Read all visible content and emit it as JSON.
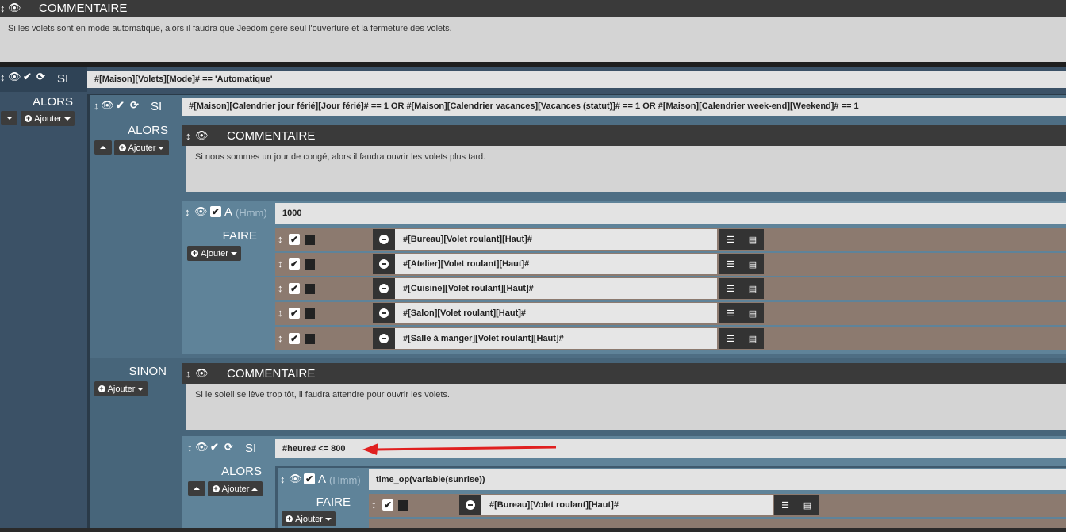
{
  "top_comment": {
    "title": "COMMENTAIRE",
    "text": "Si les volets sont en mode automatique, alors il faudra que Jeedom gère seul l'ouverture et la fermeture des volets."
  },
  "si1": {
    "keyword": "SI",
    "condition": "#[Maison][Volets][Mode]# == 'Automatique'",
    "alors": "ALORS",
    "ajouter": "Ajouter"
  },
  "si2": {
    "keyword": "SI",
    "condition": "#[Maison][Calendrier jour férié][Jour férié]# == 1 OR #[Maison][Calendrier vacances][Vacances (statut)]# == 1 OR #[Maison][Calendrier week-end][Weekend]# == 1",
    "alors": "ALORS",
    "ajouter": "Ajouter",
    "comment_title": "COMMENTAIRE",
    "comment_text": "Si nous sommes un jour de congé, alors il faudra ouvrir les volets plus tard.",
    "a_label": "A",
    "a_hint": "(Hmm)",
    "a_value": "1000",
    "faire": "FAIRE",
    "faire_ajouter": "Ajouter",
    "actions": [
      {
        "cmd": "#[Bureau][Volet roulant][Haut]#"
      },
      {
        "cmd": "#[Atelier][Volet roulant][Haut]#"
      },
      {
        "cmd": "#[Cuisine][Volet roulant][Haut]#"
      },
      {
        "cmd": "#[Salon][Volet roulant][Haut]#"
      },
      {
        "cmd": "#[Salle à manger][Volet roulant][Haut]#"
      }
    ],
    "sinon": "SINON",
    "sinon_ajouter": "Ajouter",
    "sinon_comment_title": "COMMENTAIRE",
    "sinon_comment_text": "Si le soleil se lève trop tôt, il faudra attendre pour ouvrir les volets."
  },
  "si3": {
    "keyword": "SI",
    "condition": "#heure# <= 800",
    "alors": "ALORS",
    "ajouter": "Ajouter",
    "a_label": "A",
    "a_hint": "(Hmm)",
    "a_value": "time_op(variable(sunrise))",
    "faire": "FAIRE",
    "faire_ajouter": "Ajouter",
    "actions": [
      {
        "cmd": "#[Bureau][Volet roulant][Haut]#"
      }
    ]
  },
  "colors": {
    "annotation_arrow": "#e02020",
    "action_bg": "#8c7a6f"
  },
  "icons": [
    "move-icon",
    "eye-icon",
    "check-icon",
    "refresh-icon",
    "minus-circle-icon",
    "list-options-icon",
    "list-icon",
    "plus-circle-icon",
    "caret-down-icon",
    "caret-up-icon"
  ]
}
